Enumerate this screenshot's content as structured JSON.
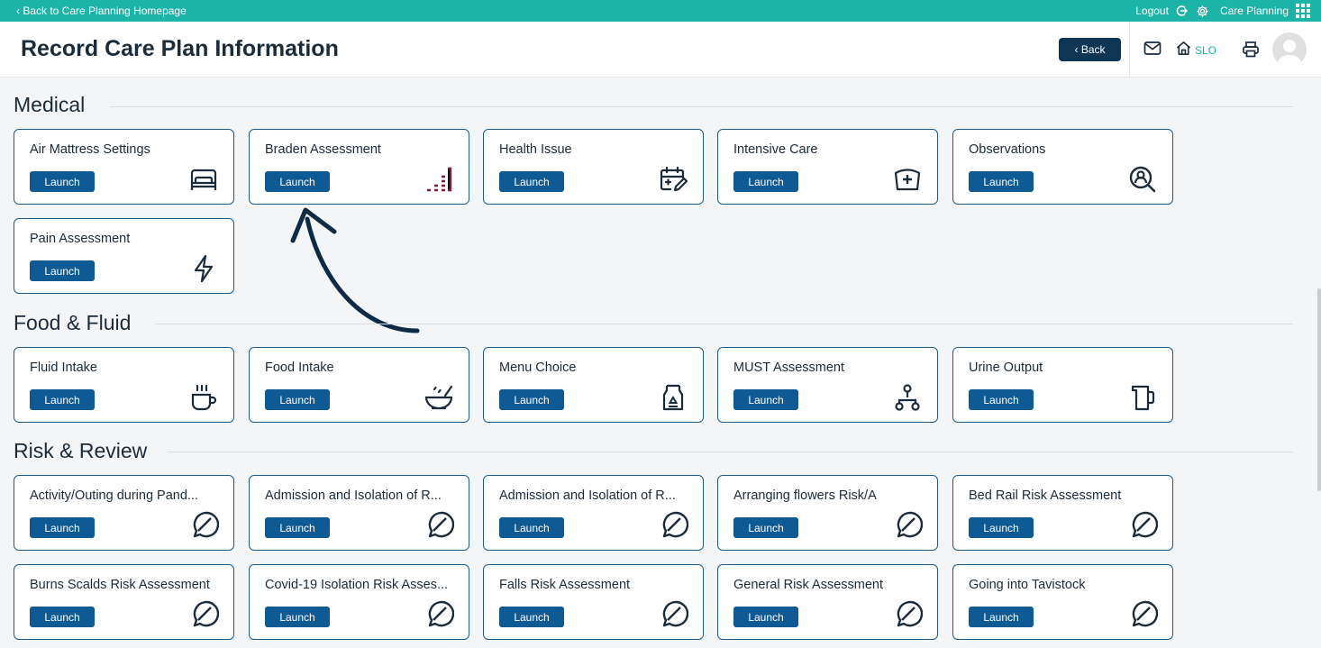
{
  "topbar": {
    "back_link": "‹ Back to Care Planning Homepage",
    "logout": "Logout",
    "app_name": "Care Planning"
  },
  "header": {
    "title": "Record Care Plan Information",
    "back_button": "‹ Back",
    "home_label": "SLO"
  },
  "colors": {
    "teal": "#1cb3a8",
    "navy": "#0e3553",
    "launch_blue": "#0d5a94",
    "card_border": "#1e5b8a",
    "braden_icon": "#7a1f3d"
  },
  "sections": {
    "medical": {
      "title": "Medical",
      "cards": [
        {
          "title": "Air Mattress Settings",
          "launch": "Launch",
          "icon": "bed-icon"
        },
        {
          "title": "Braden Assessment",
          "launch": "Launch",
          "icon": "braden-scale-icon"
        },
        {
          "title": "Health Issue",
          "launch": "Launch",
          "icon": "calendar-edit-icon"
        },
        {
          "title": "Intensive Care",
          "launch": "Launch",
          "icon": "medical-cross-icon"
        },
        {
          "title": "Observations",
          "launch": "Launch",
          "icon": "user-search-icon"
        },
        {
          "title": "Pain Assessment",
          "launch": "Launch",
          "icon": "lightning-icon"
        }
      ]
    },
    "food": {
      "title": "Food & Fluid",
      "cards": [
        {
          "title": "Fluid Intake",
          "launch": "Launch",
          "icon": "cup-icon"
        },
        {
          "title": "Food Intake",
          "launch": "Launch",
          "icon": "bowl-icon"
        },
        {
          "title": "Menu Choice",
          "launch": "Launch",
          "icon": "carton-icon"
        },
        {
          "title": "MUST Assessment",
          "launch": "Launch",
          "icon": "hierarchy-icon"
        },
        {
          "title": "Urine Output",
          "launch": "Launch",
          "icon": "jug-icon"
        }
      ]
    },
    "risk": {
      "title": "Risk & Review",
      "cards": [
        {
          "title": "Activity/Outing during Pand...",
          "launch": "Launch",
          "icon": "no-chat-icon"
        },
        {
          "title": "Admission and Isolation of R...",
          "launch": "Launch",
          "icon": "no-chat-icon"
        },
        {
          "title": "Admission and Isolation of R...",
          "launch": "Launch",
          "icon": "no-chat-icon"
        },
        {
          "title": "Arranging flowers Risk/A",
          "launch": "Launch",
          "icon": "no-chat-icon"
        },
        {
          "title": "Bed Rail Risk Assessment",
          "launch": "Launch",
          "icon": "no-chat-icon"
        },
        {
          "title": "Burns Scalds Risk Assessment",
          "launch": "Launch",
          "icon": "no-chat-icon"
        },
        {
          "title": "Covid-19 Isolation Risk Asses...",
          "launch": "Launch",
          "icon": "no-chat-icon"
        },
        {
          "title": "Falls Risk Assessment",
          "launch": "Launch",
          "icon": "no-chat-icon"
        },
        {
          "title": "General Risk Assessment",
          "launch": "Launch",
          "icon": "no-chat-icon"
        },
        {
          "title": "Going into Tavistock",
          "launch": "Launch",
          "icon": "no-chat-icon"
        }
      ]
    }
  }
}
